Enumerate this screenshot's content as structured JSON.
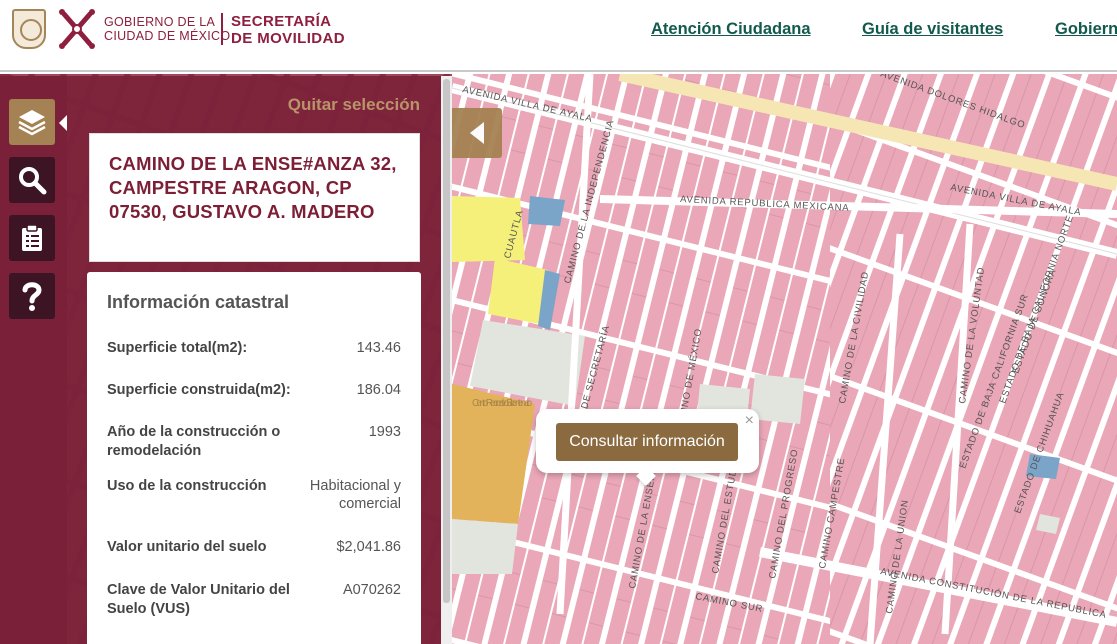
{
  "header": {
    "gov_line1": "GOBIERNO DE LA",
    "gov_line2": "CIUDAD DE MÉXICO",
    "sec_line1": "SECRETARÍA",
    "sec_line2": "DE MOVILIDAD",
    "nav": [
      "Atención Ciudadana",
      "Guía de visitantes",
      "Gobierno"
    ],
    "brand_color": "#8e1f3e",
    "nav_color": "#125a4d"
  },
  "toolbar": {
    "items": [
      {
        "icon": "layers-icon",
        "active": true
      },
      {
        "icon": "search-icon",
        "active": false
      },
      {
        "icon": "clipboard-icon",
        "active": false
      },
      {
        "icon": "help-icon",
        "active": false
      }
    ]
  },
  "panel": {
    "clear_selection": "Quitar selección",
    "address": "CAMINO DE LA ENSE#ANZA 32, CAMPESTRE ARAGON, CP 07530, GUSTAVO A. MADERO",
    "info": {
      "title": "Información catastral",
      "rows": [
        {
          "label": "Superficie total(m2):",
          "value": "143.46"
        },
        {
          "label": "Superficie construida(m2):",
          "value": "186.04"
        },
        {
          "label": "Año de la construcción o remodelación",
          "value": "1993"
        },
        {
          "label": "Uso de la construcción",
          "value": "Habitacional y comercial"
        },
        {
          "label": "Valor unitario del suelo",
          "value": "$2,041.86"
        },
        {
          "label": "Clave de Valor Unitario del Suelo (VUS)",
          "value": "A070262"
        }
      ]
    }
  },
  "map": {
    "popup_button": "Consultar información",
    "popup_close": "×",
    "streets": [
      "AVENIDA VILLA DE AYALA",
      "AVENIDA DOLORES HIDALGO",
      "AVENIDA REPUBLICA MEXICANA",
      "AVENIDA VILLA DE AYALA",
      "AVENIDA CONSTITUCIÓN DE LA REPUBLICA",
      "CAMINO SUR",
      "CAMINO DE LA UNION",
      "CAMINO DE LA VOLUNTAD",
      "ESTADO DE BAJA CALIFORNIA SUR",
      "ESTADO DE BAJA CALIFORNIA NORTE",
      "ESTADO DE CHIHUAHUA",
      "ESTADO DE SONORA",
      "CAMINO DEL ESTUDIO",
      "CAMINO DEL PROGRESO",
      "CAMINO CAMPESTRE",
      "CAMINO DE LA CIVILIDAD",
      "CAMINO DE LA ENSEÑANZA",
      "CUAUTLA",
      "CAMINO DE LA INDEPENDENCIA",
      "CAMINO DE SECRETARÍA",
      "CAMINO DE MÉXICO"
    ],
    "park_label": "Centro Recreativo Bicentenario",
    "parcel_color": "#e8a5b6",
    "street_color": "#ffffff"
  }
}
